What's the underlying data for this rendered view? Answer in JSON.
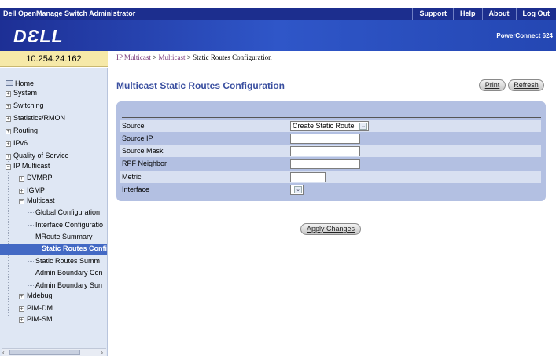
{
  "header": {
    "app_title": "Dell OpenManage Switch Administrator",
    "nav": [
      "Support",
      "Help",
      "About",
      "Log Out"
    ],
    "logo": "DƐLL",
    "product": "PowerConnect 624"
  },
  "ip_address": "10.254.24.162",
  "breadcrumb": {
    "part1": "IP Multicast",
    "sep1": " > ",
    "part2": "Multicast",
    "sep2": " > ",
    "current": "Static Routes Configuration"
  },
  "sidebar": {
    "home": "Home",
    "system": "System",
    "switching": "Switching",
    "statistics": "Statistics/RMON",
    "routing": "Routing",
    "ipv6": "IPv6",
    "qos": "Quality of Service",
    "ip_multicast": "IP Multicast",
    "dvmrp": "DVMRP",
    "igmp": "IGMP",
    "multicast": "Multicast",
    "global_config": "Global Configuration",
    "interface_config": "Interface Configuratio",
    "mroute_summary": "MRoute Summary",
    "static_routes_config": "Static Routes Confi",
    "static_routes_summary": "Static Routes Summ",
    "admin_boundary_config": "Admin Boundary Con",
    "admin_boundary_summary": "Admin Boundary Sun",
    "mdebug": "Mdebug",
    "pim_dm": "PIM-DM",
    "pim_sm": "PIM-SM"
  },
  "page": {
    "title": "Multicast Static Routes Configuration",
    "print": "Print",
    "refresh": "Refresh",
    "apply": "Apply Changes"
  },
  "form": {
    "source_label": "Source",
    "source_value": "Create Static Route",
    "source_ip_label": "Source IP",
    "source_ip_value": "",
    "source_mask_label": "Source Mask",
    "source_mask_value": "",
    "rpf_label": "RPF Neighbor",
    "rpf_value": "",
    "metric_label": "Metric",
    "metric_value": "",
    "interface_label": "Interface",
    "interface_value": ""
  }
}
